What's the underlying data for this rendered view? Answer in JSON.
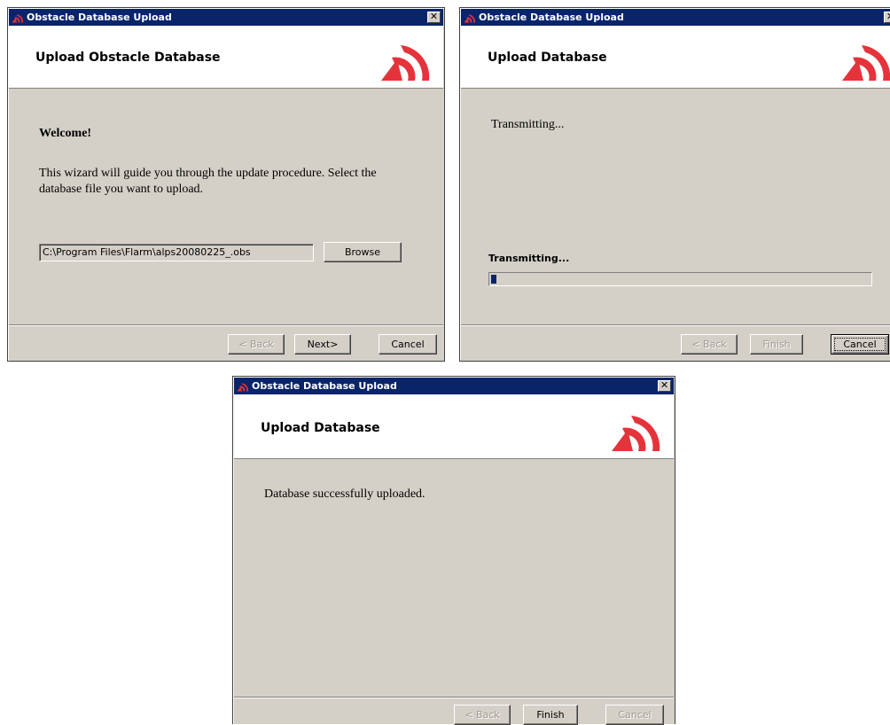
{
  "app_title": "Obstacle Database Upload",
  "colors": {
    "titlebar": "#0a246a",
    "accent_red": "#e5333b",
    "dialog_bg": "#d4d0c8"
  },
  "icons": {
    "app": "flarm-logo-icon",
    "close": "close-icon"
  },
  "dialog1": {
    "close_glyph": "✕",
    "header_title": "Upload Obstacle Database",
    "welcome_heading": "Welcome!",
    "intro_line1": "This wizard will guide you through the update procedure. Select the",
    "intro_line2": "database file you want to upload.",
    "file_path": "C:\\Program Files\\Flarm\\alps20080225_.obs",
    "browse_label": "Browse",
    "back_label": "< Back",
    "next_label": "Next>",
    "cancel_label": "Cancel"
  },
  "dialog2": {
    "close_glyph": "✕",
    "header_title": "Upload Database",
    "status_text": "Transmitting...",
    "progress_label": "Transmitting...",
    "progress_fraction": 0.015,
    "back_label": "< Back",
    "finish_label": "Finish",
    "cancel_label": "Cancel"
  },
  "dialog3": {
    "close_glyph": "✕",
    "header_title": "Upload Database",
    "message": "Database successfully uploaded.",
    "back_label": "< Back",
    "finish_label": "Finish",
    "cancel_label": "Cancel"
  }
}
